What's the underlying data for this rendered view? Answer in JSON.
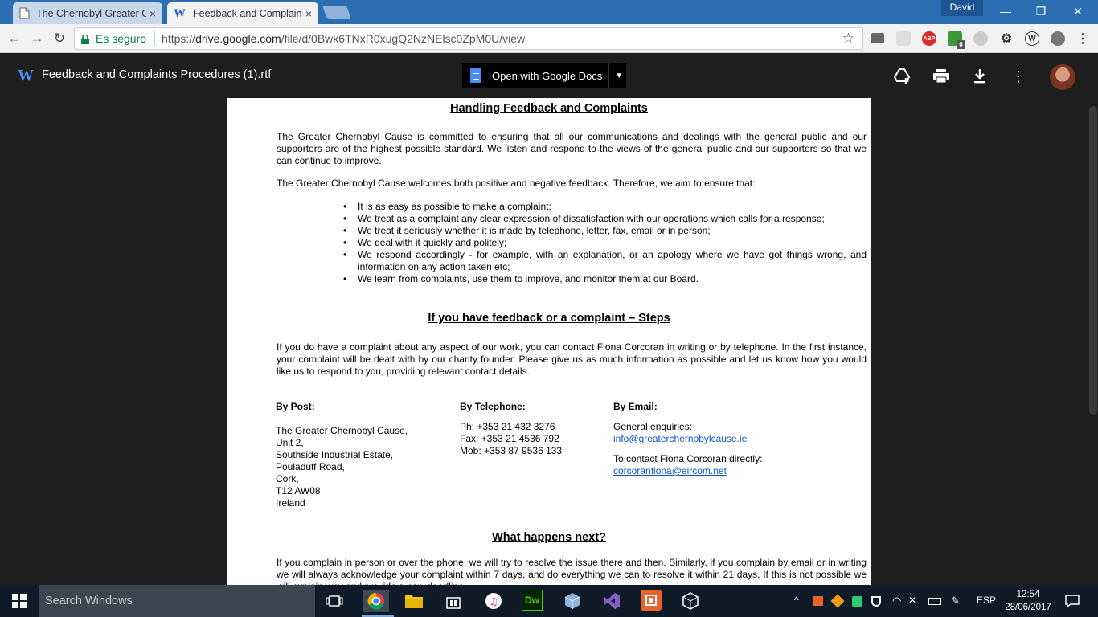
{
  "browser": {
    "tabs": [
      {
        "label": "The Chernobyl Greater C",
        "close": "×"
      },
      {
        "label": "Feedback and Complaint",
        "close": "×"
      }
    ],
    "profile": "David",
    "window": {
      "minimize": "—",
      "restore": "❐",
      "close": "✕"
    },
    "nav": {
      "back": "←",
      "forward": "→",
      "reload": "↻"
    },
    "secure_label": "Es seguro",
    "url_scheme": "https://",
    "url_host": "drive.google.com",
    "url_path": "/file/d/0Bwk6TNxR0xugQ2NzNElsc0ZpM0U/view",
    "star": "☆",
    "extensions": {
      "abp": "ABP",
      "badge": "0",
      "w": "W"
    }
  },
  "viewer": {
    "file_icon": "W",
    "file_title": "Feedback and Complaints Procedures (1).rtf",
    "open_button": "Open with Google Docs",
    "caret": "▼"
  },
  "document": {
    "heading1": "Handling Feedback and Complaints",
    "para1": "The Greater Chernobyl Cause is committed to ensuring that all our communications and dealings with the general public and our supporters are of the highest possible standard. We listen and respond to the views of the general public and our supporters so that we can continue to improve.",
    "para2": "The Greater Chernobyl Cause welcomes both positive and negative feedback. Therefore, we aim to ensure that:",
    "bullets": [
      "It is as easy as possible to make a complaint;",
      "We treat as a complaint any clear expression of dissatisfaction with our operations which calls for a response;",
      "We treat it seriously whether it is made by telephone, letter, fax, email or in person;",
      "We deal with it quickly and politely;",
      " We respond accordingly - for example, with an explanation, or an apology where we have got things wrong, and information on any action taken etc;",
      "We learn from complaints, use them to improve, and monitor them at our Board."
    ],
    "heading2": "If you have feedback or a complaint – Steps",
    "para3": "If you do have a complaint about any aspect of our work, you can contact Fiona Corcoran in writing or by telephone. In the first instance, your complaint will be dealt with by our charity founder. Please give us as much information as possible and let us know how you would like us to respond to you, providing relevant contact details.",
    "post": {
      "title": "By Post:",
      "lines": [
        "The Greater Chernobyl Cause,",
        "Unit 2,",
        "Southside Industrial Estate,",
        "Pouladuff Road,",
        "Cork,",
        "T12 AW08",
        "Ireland"
      ]
    },
    "telephone": {
      "title": "By Telephone:",
      "ph": "Ph: +353 21 432 3276",
      "fax": "Fax: +353 21 4536 792",
      "mob": "Mob: +353 87 9536 133"
    },
    "email": {
      "title": "By Email:",
      "general_label": "General enquiries:",
      "general_email": " info@greaterchernobylcause.ie",
      "direct_label": "To contact Fiona Corcoran directly:",
      "direct_email": " corcoranfiona@eircom.net"
    },
    "heading3": "What happens next?",
    "para4": "If you complain in person or over the phone, we will try to resolve the issue there and then. Similarly, if you complain by email or in writing we will always acknowledge your complaint within 7 days, and do everything we can to resolve it within 21 days. If this is not possible we will explain why and provide a new deadline."
  },
  "taskbar": {
    "search_placeholder": "Search Windows",
    "dreamweaver": "Dw",
    "tray_chevron": "^",
    "lang": "ESP",
    "time": "12:54",
    "date": "28/06/2017"
  },
  "colors": {
    "tabstrip": "#2b6fb2",
    "secure_green": "#0b8043",
    "link_blue": "#1155cc",
    "viewer_bg": "#1e1e1e",
    "taskbar": "#101b2a"
  }
}
